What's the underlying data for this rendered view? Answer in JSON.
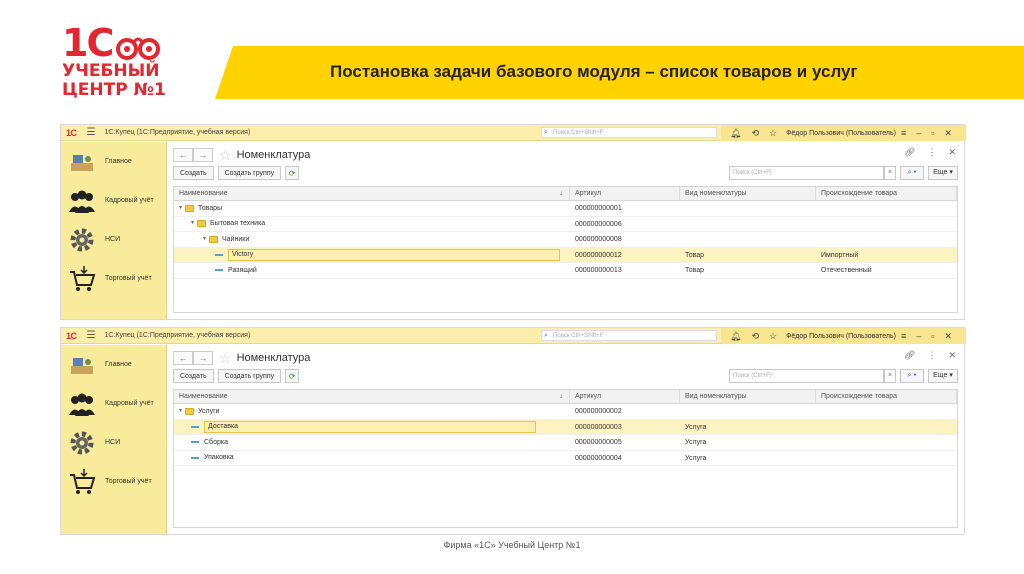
{
  "logo": {
    "brand": "1C",
    "line1": "УЧЕБНЫЙ",
    "line2": "ЦЕНТР №1",
    "color": "#e3262f"
  },
  "banner": {
    "title": "Постановка задачи базового модуля – список товаров и услуг",
    "color": "#ffd200"
  },
  "window1": {
    "titlebar": {
      "brand": "1С",
      "title": "1С:Купец  (1С:Предприятие, учебная версия)",
      "search_placeholder": "Поиск Ctrl+Shift+F",
      "user": "Фёдор Пользович (Пользователь)"
    },
    "sidebar": [
      {
        "label": "Главное"
      },
      {
        "label": "Кадровый учёт"
      },
      {
        "label": "НСИ"
      },
      {
        "label": "Торговый учёт"
      }
    ],
    "form_title": "Номенклатура",
    "buttons": {
      "create": "Создать",
      "create_group": "Создать группу",
      "more": "Еще"
    },
    "search_placeholder": "Поиск (Ctrl+F)",
    "columns": [
      "Наименование",
      "Артикул",
      "Вид номенклатуры",
      "Происхождение товара"
    ],
    "rows": [
      {
        "level": 0,
        "kind": "folder",
        "expanded": true,
        "name": "Товары",
        "article": "000000000001",
        "type": "",
        "origin": "",
        "selected": false
      },
      {
        "level": 1,
        "kind": "folder",
        "expanded": true,
        "name": "Бытовая техника",
        "article": "000000000006",
        "type": "",
        "origin": "",
        "selected": false
      },
      {
        "level": 2,
        "kind": "folder",
        "expanded": true,
        "name": "Чайники",
        "article": "000000000008",
        "type": "",
        "origin": "",
        "selected": false
      },
      {
        "level": 3,
        "kind": "item",
        "name": "Victory",
        "article": "000000000012",
        "type": "Товар",
        "origin": "Импортный",
        "selected": true
      },
      {
        "level": 3,
        "kind": "item",
        "name": "Разящий",
        "article": "000000000013",
        "type": "Товар",
        "origin": "Отечественный",
        "selected": false
      }
    ]
  },
  "window2": {
    "titlebar": {
      "brand": "1С",
      "title": "1С:Купец  (1С:Предприятие, учебная версия)",
      "search_placeholder": "Поиск Ctrl+Shift+F",
      "user": "Фёдор Пользович (Пользователь)"
    },
    "sidebar": [
      {
        "label": "Главное"
      },
      {
        "label": "Кадровый учёт"
      },
      {
        "label": "НСИ"
      },
      {
        "label": "Торговый учёт"
      }
    ],
    "form_title": "Номенклатура",
    "buttons": {
      "create": "Создать",
      "create_group": "Создать группу",
      "more": "Еще"
    },
    "search_placeholder": "Поиск (Ctrl+F)",
    "columns": [
      "Наименование",
      "Артикул",
      "Вид номенклатуры",
      "Происхождение товара"
    ],
    "rows": [
      {
        "level": 0,
        "kind": "folder",
        "expanded": true,
        "name": "Услуги",
        "article": "000000000002",
        "type": "",
        "origin": "",
        "selected": false
      },
      {
        "level": 1,
        "kind": "item",
        "name": "Доставка",
        "article": "000000000003",
        "type": "Услуга",
        "origin": "",
        "selected": true
      },
      {
        "level": 1,
        "kind": "item",
        "name": "Сборка",
        "article": "000000000005",
        "type": "Услуга",
        "origin": "",
        "selected": false
      },
      {
        "level": 1,
        "kind": "item",
        "name": "Упаковка",
        "article": "000000000004",
        "type": "Услуга",
        "origin": "",
        "selected": false
      }
    ]
  },
  "footer": {
    "text": "Фирма «1С» Учебный Центр №1"
  }
}
